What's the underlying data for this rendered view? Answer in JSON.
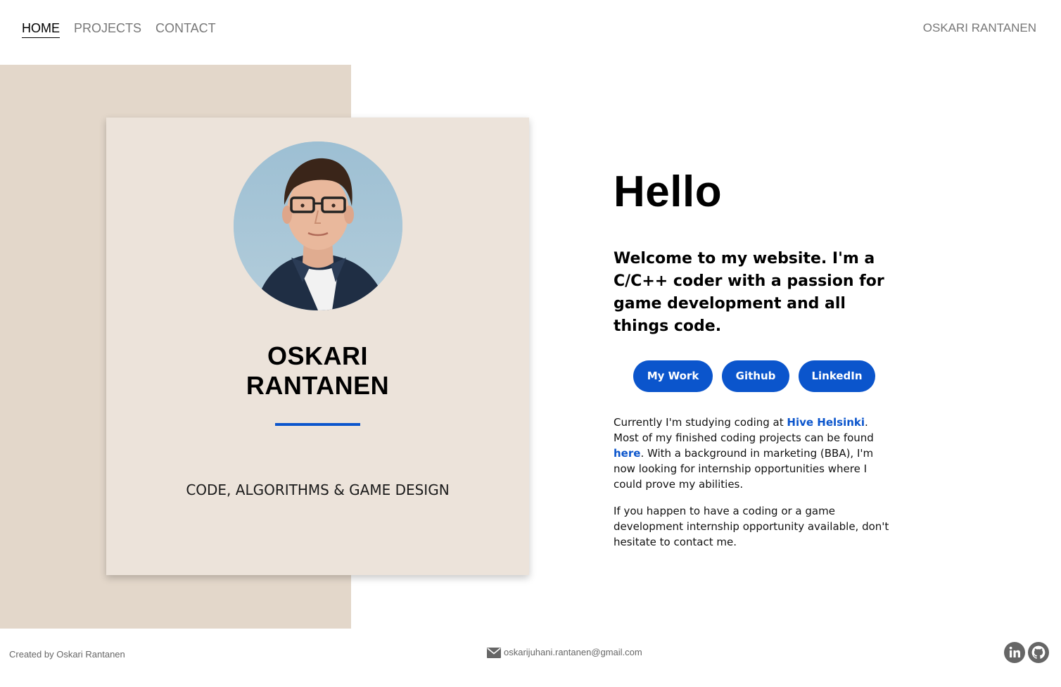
{
  "nav": {
    "links": [
      {
        "label": "HOME",
        "active": true
      },
      {
        "label": "PROJECTS",
        "active": false
      },
      {
        "label": "CONTACT",
        "active": false
      }
    ],
    "brand": "OSKARI RANTANEN"
  },
  "card": {
    "name_line1": "OSKARI",
    "name_line2": "RANTANEN",
    "tagline": "CODE, ALGORITHMS & GAME DESIGN",
    "avatar_icon": "profile-photo"
  },
  "main": {
    "heading": "Hello",
    "welcome": "Welcome to my website. I'm a C/C++ coder with a passion for game development and all things code.",
    "buttons": {
      "my_work": "My Work",
      "github": "Github",
      "linkedin": "LinkedIn"
    },
    "para1": {
      "before_hive": "Currently I'm studying coding at ",
      "hive_link": "Hive Helsinki",
      "before_here": ". Most of my finished coding projects can be found ",
      "here_link": "here",
      "after_here": ". With a background in marketing (BBA), I'm now looking for internship opportunities where I could prove my abilities."
    },
    "para2": "If you happen to have a coding or a game development internship opportunity available, don't hesitate to contact me."
  },
  "footer": {
    "credit": "Created by Oskari Rantanen",
    "email": "oskarijuhani.rantanen@gmail.com",
    "email_icon": "envelope-icon",
    "social_icons": [
      "linkedin-icon",
      "github-icon"
    ]
  },
  "colors": {
    "accent": "#0b55cc",
    "beige_bg": "#e3d7ca",
    "card_bg": "#ece3da",
    "nav_text": "#777777"
  }
}
